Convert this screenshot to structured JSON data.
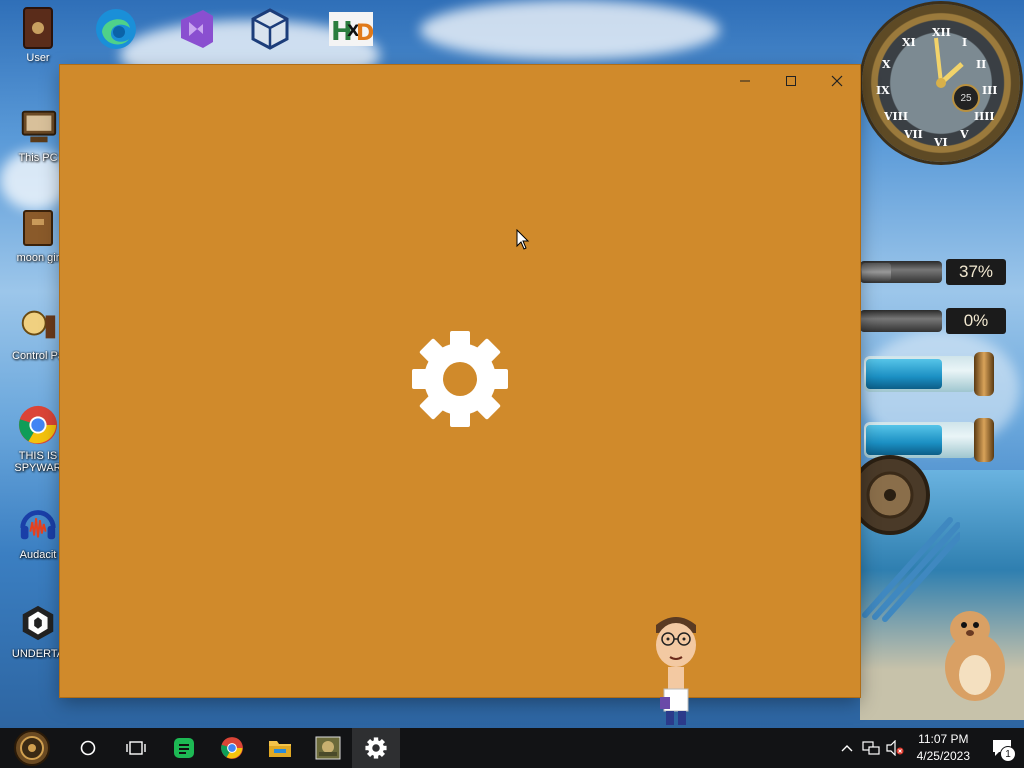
{
  "desktop": {
    "top_icons": [
      {
        "label": "User",
        "icon": "user-folder-icon"
      },
      {
        "label": "",
        "icon": "edge-icon"
      },
      {
        "label": "",
        "icon": "visual-studio-icon"
      },
      {
        "label": "",
        "icon": "virtualbox-icon"
      },
      {
        "label": "",
        "icon": "hxd-icon"
      }
    ],
    "left_icons": [
      {
        "label": "This PC",
        "icon": "computer-icon"
      },
      {
        "label": "moon gir",
        "icon": "box-icon"
      },
      {
        "label": "Control Pa",
        "icon": "control-panel-icon"
      },
      {
        "label": "THIS IS",
        "label2": "SPYWAR",
        "icon": "chrome-icon"
      },
      {
        "label": "Audacit",
        "icon": "audacity-icon"
      },
      {
        "label": "UNDERTA",
        "icon": "unity-icon"
      }
    ]
  },
  "window": {
    "app": "Settings",
    "background_color": "#d08a2b",
    "controls": {
      "minimize": "—",
      "maximize": "☐",
      "close": "✕"
    },
    "splash_icon": "gear-icon"
  },
  "gadgets": {
    "clock": {
      "numerals": [
        "XII",
        "I",
        "II",
        "III",
        "IIII",
        "V",
        "VI",
        "VII",
        "VIII",
        "IX",
        "X",
        "XI"
      ],
      "date_dial": "25"
    },
    "cpu_meter": {
      "value": "37%",
      "fraction": 0.37
    },
    "ram_meter": {
      "value": "0%",
      "fraction": 0.0
    }
  },
  "taskbar": {
    "items": [
      {
        "name": "start-button",
        "icon": "steampunk-start-icon"
      },
      {
        "name": "search-button",
        "icon": "cortana-circle-icon"
      },
      {
        "name": "task-view-button",
        "icon": "task-view-icon"
      },
      {
        "name": "taskbar-app-1",
        "icon": "green-chat-icon"
      },
      {
        "name": "taskbar-chrome",
        "icon": "chrome-icon"
      },
      {
        "name": "taskbar-file-explorer",
        "icon": "folder-icon"
      },
      {
        "name": "taskbar-game",
        "icon": "game-thumbnail-icon"
      },
      {
        "name": "taskbar-settings",
        "icon": "gear-icon",
        "active": true
      }
    ],
    "tray": {
      "time": "11:07 PM",
      "date": "4/25/2023",
      "notification_count": "1"
    }
  }
}
